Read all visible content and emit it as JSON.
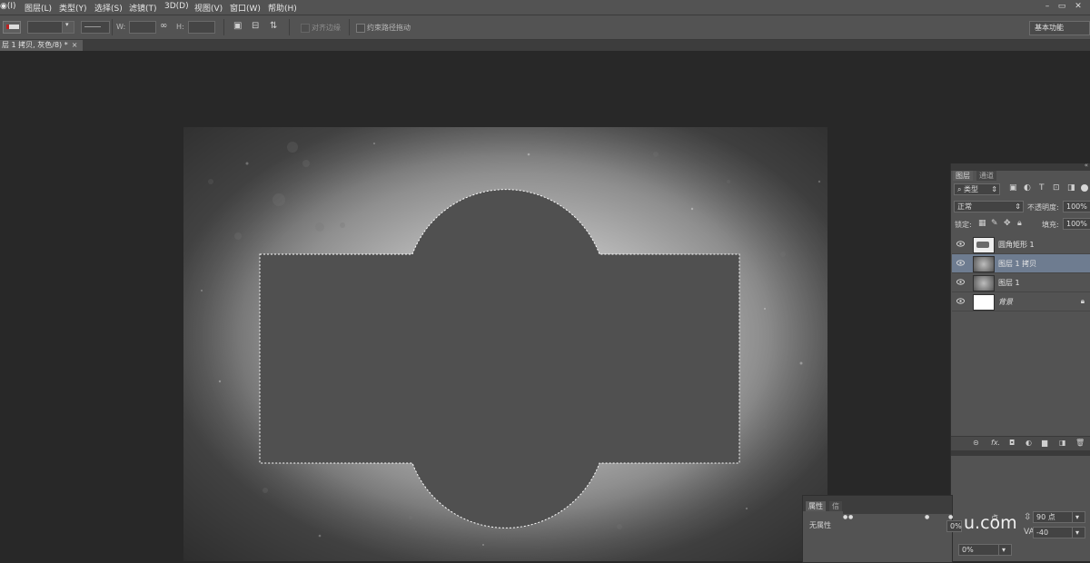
{
  "menu": {
    "items": [
      "◉(I)",
      "图层(L)",
      "类型(Y)",
      "选择(S)",
      "滤镜(T)",
      "3D(D)",
      "视图(V)",
      "窗口(W)",
      "帮助(H)"
    ],
    "window_controls": [
      "–",
      "▭",
      "✕"
    ]
  },
  "options_bar": {
    "w_label": "W:",
    "h_label": "H:",
    "align_edges_label": "对齐边缘",
    "constrain_path_label": "约束路径拖动",
    "workspace": "基本功能"
  },
  "document_tab": {
    "title": "层 1 拷贝, 灰色/8) *",
    "close": "×"
  },
  "layers_panel": {
    "tabs": [
      "图层",
      "通道"
    ],
    "filter_kind": "类型",
    "blend_mode": "正常",
    "opacity_label": "不透明度:",
    "opacity_value": "100%",
    "lock_label": "锁定:",
    "fill_label": "填充:",
    "fill_value": "100%",
    "layers": [
      {
        "name": "圆角矩形 1",
        "selected": false,
        "locked": false
      },
      {
        "name": "图层 1 拷贝",
        "selected": true,
        "locked": false
      },
      {
        "name": "图层 1",
        "selected": false,
        "locked": false
      },
      {
        "name": "背景",
        "selected": false,
        "locked": true
      }
    ],
    "footer_icons": [
      "link-icon",
      "fx-icon",
      "mask-icon",
      "adjustment-icon",
      "folder-icon",
      "new-layer-icon",
      "trash-icon"
    ],
    "footer_labels": [
      "⊝",
      "fx.",
      "◘",
      "◐",
      "▆",
      "◨",
      "🗑"
    ]
  },
  "properties_panel": {
    "tabs": [
      "属性",
      "信"
    ],
    "no_properties": "无属性"
  },
  "character_fragment": {
    "size_suffix": "点",
    "leading": "90 点",
    "tracking": "-40",
    "scale_value": "0%",
    "percent_field": "0%"
  },
  "watermark": "u.com",
  "colors": {
    "menubar": "#535353",
    "workspace": "#282828",
    "selection_fill": "#505050",
    "selected_layer": "#6e7c90"
  }
}
